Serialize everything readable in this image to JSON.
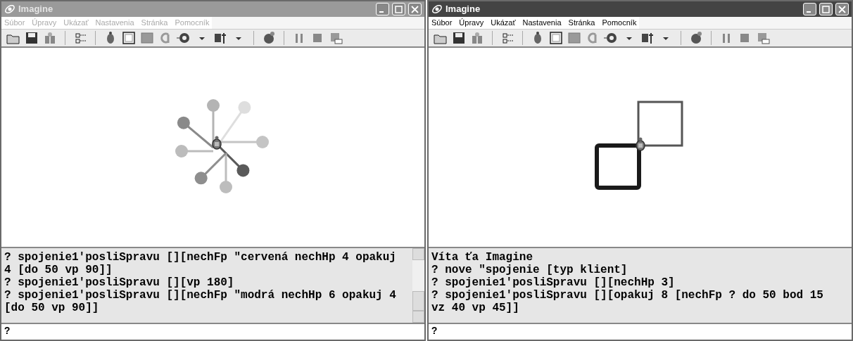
{
  "windows": [
    {
      "title": "Imagine",
      "active": false,
      "menu": [
        "Súbor",
        "Úpravy",
        "Ukázať",
        "Nastavenia",
        "Stránka",
        "Pomocník"
      ],
      "kind": "pinwheel",
      "console_scrollbar": true,
      "console_lines": [
        "? spojenie1'posliSpravu [][nechFp \"cervená nechHp 4 opakuj 4 [do 50 vp 90]]",
        "? spojenie1'posliSpravu [][vp 180]",
        "? spojenie1'posliSpravu [][nechFp \"modrá nechHp 6 opakuj 4 [do 50 vp 90]]"
      ],
      "input": "?"
    },
    {
      "title": "Imagine",
      "active": true,
      "menu": [
        "Súbor",
        "Úpravy",
        "Ukázať",
        "Nastavenia",
        "Stránka",
        "Pomocník"
      ],
      "kind": "squares",
      "console_scrollbar": false,
      "console_lines": [
        "Víta ťa Imagine",
        "? nove \"spojenie [typ klient]",
        "? spojenie1'posliSpravu [][nechHp 3]",
        "? spojenie1'posliSpravu [][opakuj 8 [nechFp ? do 50 bod 15 vz 40 vp 45]]"
      ],
      "input": "?"
    }
  ]
}
